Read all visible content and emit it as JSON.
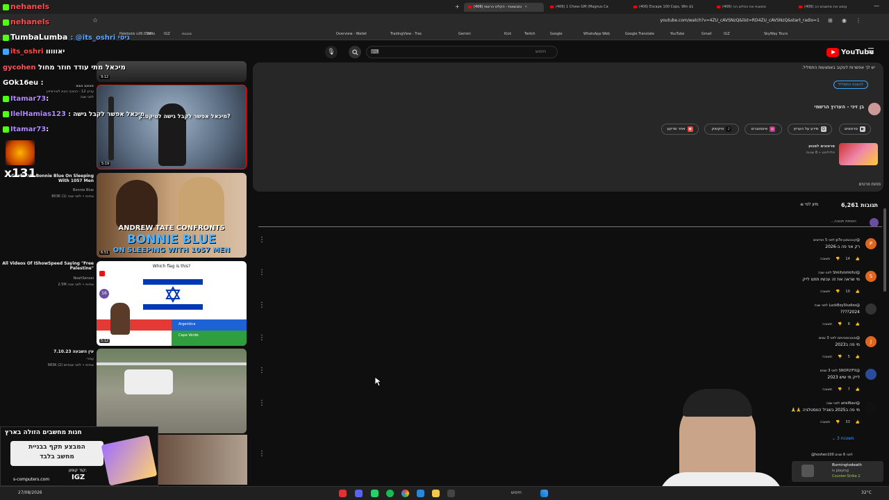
{
  "tabs": [
    {
      "label": "(406) נתבשוטת - הקליפ הרשמי",
      "active": true
    },
    {
      "label": "(406) 1 Chess GM (Magnus Ca",
      "active": false
    },
    {
      "label": "(406) Escape 100 Cops, Win $1",
      "active": false
    },
    {
      "label": "(406) סמוצות את הפלים הכי",
      "active": false
    },
    {
      "label": "(406) עזמנו את מחשבים הכ",
      "active": false
    }
  ],
  "new_tab": "+",
  "address": {
    "url": "youtube.com/watch?v=4ZU_cAVSNzQ&list=RD4ZU_cAVSNzQ&start_radio=1"
  },
  "bookmarks": [
    "Paletools v26.0.28",
    "Trello",
    "IGZ",
    "סוכנות",
    "Overview - Wallet",
    "TradingView - Trac",
    "Gemini",
    "Kick",
    "Twitch",
    "Google",
    "WhatsApp Web",
    "Google Translate",
    "YouTube",
    "Gmail",
    "IGZ",
    "SkyWay Tours"
  ],
  "masthead": {
    "search_placeholder": "חיפוש",
    "logo": "YouTube"
  },
  "description": {
    "line1": "יש לך אפשרות לעקוב באמצעות התמליל.",
    "show_transcript": "להצגת התמליל",
    "channel_name": "בן זיני - הערוץ הרשמי",
    "channel_subs": "",
    "links": [
      "סרטונים",
      "מידע על הערוץ",
      "אינסטגרם",
      "טיקטוק",
      "אתר מרקע"
    ],
    "playlist_title": "סרטונים למנוע",
    "playlist_sub": "פלייליסט ∙ 8 שניות",
    "less": "פחות פרטים"
  },
  "comments_header": {
    "count": "6,261 תגובות",
    "sort": "מיון לפי"
  },
  "add_comment": "הוספת תגובה...",
  "comments": [
    {
      "author": "@קטכומטן-p7s לפני 5 חודשים",
      "text": "רק אני פה ב-2026",
      "likes": "14",
      "reply": "תשובה",
      "avatar": "P",
      "color": "#e0661c"
    },
    {
      "author": "@Shkifutshkiful לפני שנה",
      "text": "מי שראה את זה עכשיו תתנו לייק",
      "likes": "10",
      "reply": "תשובה",
      "avatar": "S",
      "color": "#e0661c"
    },
    {
      "author": "@LuckBoyStudios לפני שנה",
      "text": "2024????",
      "likes": "8",
      "reply": "תשובה",
      "avatar": "",
      "color": "#333"
    },
    {
      "author": "@טוטכוסביותמ לפני 3 שנים",
      "text": "מי פה ב2023",
      "likes": "5",
      "reply": "תשובה",
      "avatar": "J",
      "color": "#e0661c"
    },
    {
      "author": "@SNOPLYFX לפני 3 שנים",
      "text": "לייק מי שיש 2023",
      "likes": "7",
      "reply": "תשובה",
      "avatar": "",
      "color": "#2b4c9a"
    },
    {
      "author": "@arielNavi לפני שנה",
      "text": "מי פה ב2025 בשביל הנוסטלגיה 🙏🙏",
      "likes": "33",
      "reply": "תשובה",
      "avatar": "",
      "color": "#111"
    }
  ],
  "replies_toggle": "3 תשובות",
  "last_comment_author": "@hoshen100 לפני 6 שנים",
  "chat": [
    {
      "user": "nehanels",
      "msg": "",
      "color": "#ff4b4b"
    },
    {
      "user": "nehanels",
      "msg": "",
      "color": "#ff4b4b"
    },
    {
      "user": "TumbaLumba",
      "msg": ": @its_oshri גיסי",
      "color": "#ffffff"
    },
    {
      "user": "its_oshri",
      "msg": "יאווווו",
      "color": "#ff4b4b"
    },
    {
      "user": "gycohen",
      "msg": "מיכאל מתי עודד חוזר מחול",
      "color": "#ff5555"
    },
    {
      "user": "GOk16eu",
      "msg": ":",
      "color": "#ffffff"
    },
    {
      "user": "Itamar73",
      "msg": ":",
      "color": "#b28cff"
    },
    {
      "user": "IlelHamias123",
      "msg": ": מיכאל אפשר לקבל גישה",
      "color": "#b28cff"
    },
    {
      "user": "Itamar73",
      "msg": ":",
      "color": "#b28cff"
    }
  ],
  "gift": "x131",
  "recommendations": [
    {
      "duration": "9:12",
      "title": "",
      "meta1": "",
      "meta2": ""
    },
    {
      "duration": "5:19",
      "title": "הכוכב הבא",
      "meta1": "ערוץ 12 - הכוכב הבא לאירוויזיון",
      "meta2": "לפני שנה"
    },
    {
      "duration": "6:51",
      "title": "Confronts Bonnie Blue On Sleeping With 1057 Men",
      "meta1": "Bonnie Blue",
      "meta2": "803K צפיות ∙ לפני שנה (1)"
    },
    {
      "duration": "5:12",
      "title": "All Videos Of IShowSpeed Saying \"Free Palestine\"",
      "meta1": "NoahSensei",
      "meta2": "2.5M צפיות ∙ לפני שנה"
    },
    {
      "duration": "",
      "title": "עין השבעה 7.10.23",
      "meta1": "עמרי",
      "meta2": "983K צפיות ∙ לפני שנתיים (2)"
    }
  ],
  "thumb_text": {
    "andrew": "ANDREW TATE CONFRONTS",
    "bonnie": "BONNIE BLUE",
    "sleeping": "ON SLEEPING WITH 1057 MEN",
    "flag_q": "Which flag is this?",
    "flag_num": "16",
    "opt1": "Cuba",
    "opt2": "Argentina",
    "opt3": "Cape Verde",
    "singer_caption": "מיכאל אפשר לקבל גישה לטיקטוק?"
  },
  "ad": {
    "headline": "חנות מחשבים הזולה בארץ",
    "sub1": "המבצע תקף בבניית",
    "sub2": "מחשב בלבד",
    "code_label": "קוד קופון:",
    "code": "IGZ",
    "site": "s-computers.com",
    "brand": "Smart Computers"
  },
  "toast": {
    "name": "Burningtodeath",
    "status": "is playing",
    "game": "Counter-Strike 2"
  },
  "taskbar": {
    "date": "27/08/2026",
    "search": "חיפוש",
    "temp": "32°C"
  },
  "colors": {
    "yt_red": "#ff0000",
    "bg": "#0f0f0f",
    "panel": "#272727"
  }
}
